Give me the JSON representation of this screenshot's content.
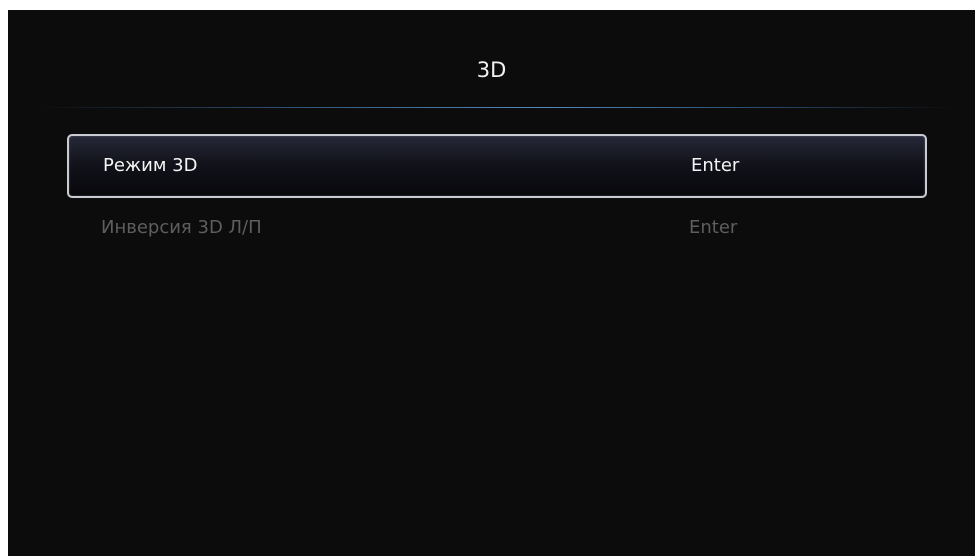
{
  "header": {
    "title": "3D"
  },
  "menu": {
    "items": [
      {
        "label": "Режим 3D",
        "value": "Enter",
        "selected": true
      },
      {
        "label": "Инверсия 3D Л/П",
        "value": "Enter",
        "selected": false
      }
    ]
  },
  "colors": {
    "background": "#0c0c0c",
    "selected_text": "#f5f5f5",
    "inactive_text": "#5e5e5e",
    "divider_accent": "#5a96d2"
  }
}
